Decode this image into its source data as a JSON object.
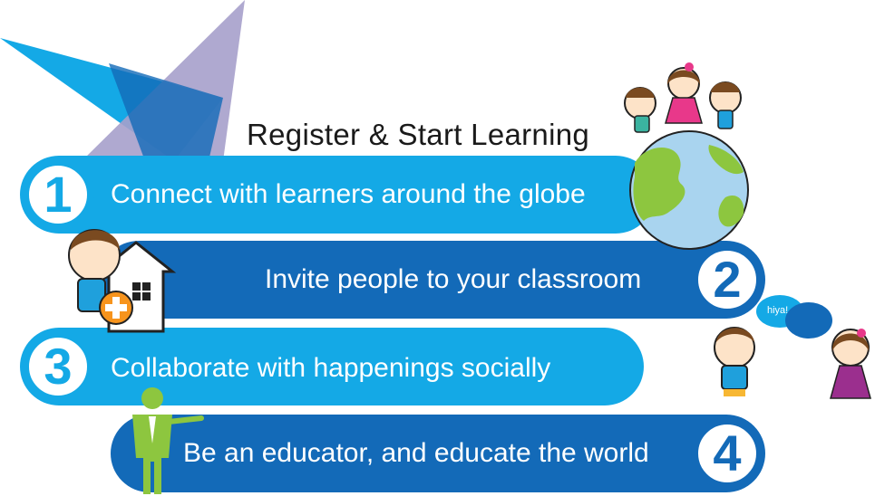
{
  "title": "Register & Start Learning",
  "steps": [
    {
      "number": "1",
      "text": "Connect with learners around the globe"
    },
    {
      "number": "2",
      "text": "Invite people to your classroom"
    },
    {
      "number": "3",
      "text": "Collaborate with happenings socially"
    },
    {
      "number": "4",
      "text": "Be an educator, and educate the world"
    }
  ],
  "speech_bubble": "hiya!",
  "colors": {
    "light_blue": "#14a9e6",
    "dark_blue": "#136ab8",
    "globe_green": "#8dc63f",
    "globe_blue": "#a9d4ef",
    "purple": "#a6a0cb"
  }
}
